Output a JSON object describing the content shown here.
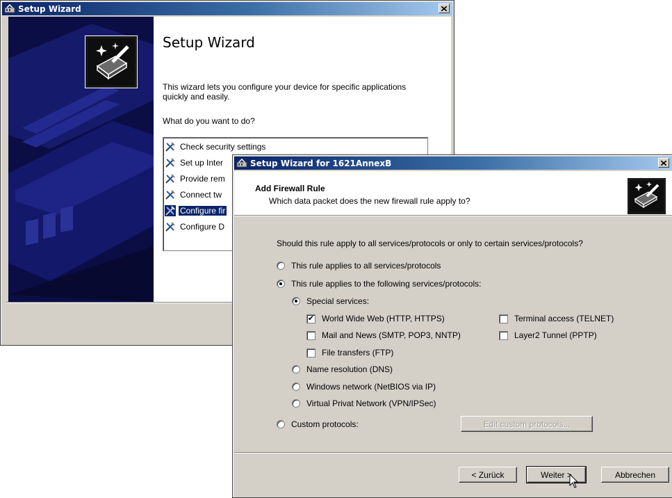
{
  "back_window": {
    "title": "Setup Wizard",
    "heading": "Setup Wizard",
    "intro": "This wizard lets you configure your device for specific applications quickly and easily.",
    "question": "What do you want to do?",
    "tasks": [
      {
        "label": "Check security settings",
        "selected": false
      },
      {
        "label": "Set up Inter",
        "selected": false
      },
      {
        "label": "Provide rem",
        "selected": false
      },
      {
        "label": "Connect tw",
        "selected": false
      },
      {
        "label": "Configure fir",
        "selected": true
      },
      {
        "label": "Configure D",
        "selected": false
      }
    ]
  },
  "front_window": {
    "title": "Setup Wizard for 1621AnnexB",
    "page_title": "Add Firewall Rule",
    "page_subtitle": "Which data packet does the new firewall rule apply to?",
    "question": "Should this rule apply to all services/protocols or only to certain services/protocols?",
    "scope_options": {
      "all": {
        "label": "This rule applies to all services/protocols",
        "selected": false
      },
      "following": {
        "label": "This rule applies to the following services/protocols:",
        "selected": true
      }
    },
    "service_options": {
      "special": {
        "label": "Special services:",
        "selected": true
      },
      "dns": {
        "label": "Name resolution (DNS)",
        "selected": false
      },
      "netbios": {
        "label": "Windows network (NetBIOS via IP)",
        "selected": false
      },
      "vpn": {
        "label": "Virtual Privat Network (VPN/IPSec)",
        "selected": false
      }
    },
    "special_services": {
      "www": {
        "label": "World Wide Web (HTTP, HTTPS)",
        "checked": true
      },
      "mail": {
        "label": "Mail and News (SMTP, POP3, NNTP)",
        "checked": false
      },
      "ftp": {
        "label": "File transfers (FTP)",
        "checked": false
      },
      "telnet": {
        "label": "Terminal access (TELNET)",
        "checked": false
      },
      "pptp": {
        "label": "Layer2 Tunnel (PPTP)",
        "checked": false
      }
    },
    "custom": {
      "label": "Custom protocols:",
      "selected": false,
      "edit_button": "Edit custom protocols..."
    },
    "buttons": {
      "back": "< Zurück",
      "next": "Weiter >",
      "cancel": "Abbrechen"
    }
  },
  "colors": {
    "titlebar_active": "#0a246a",
    "dialog_face": "#d4d0c8",
    "selection": "#0a246a"
  }
}
